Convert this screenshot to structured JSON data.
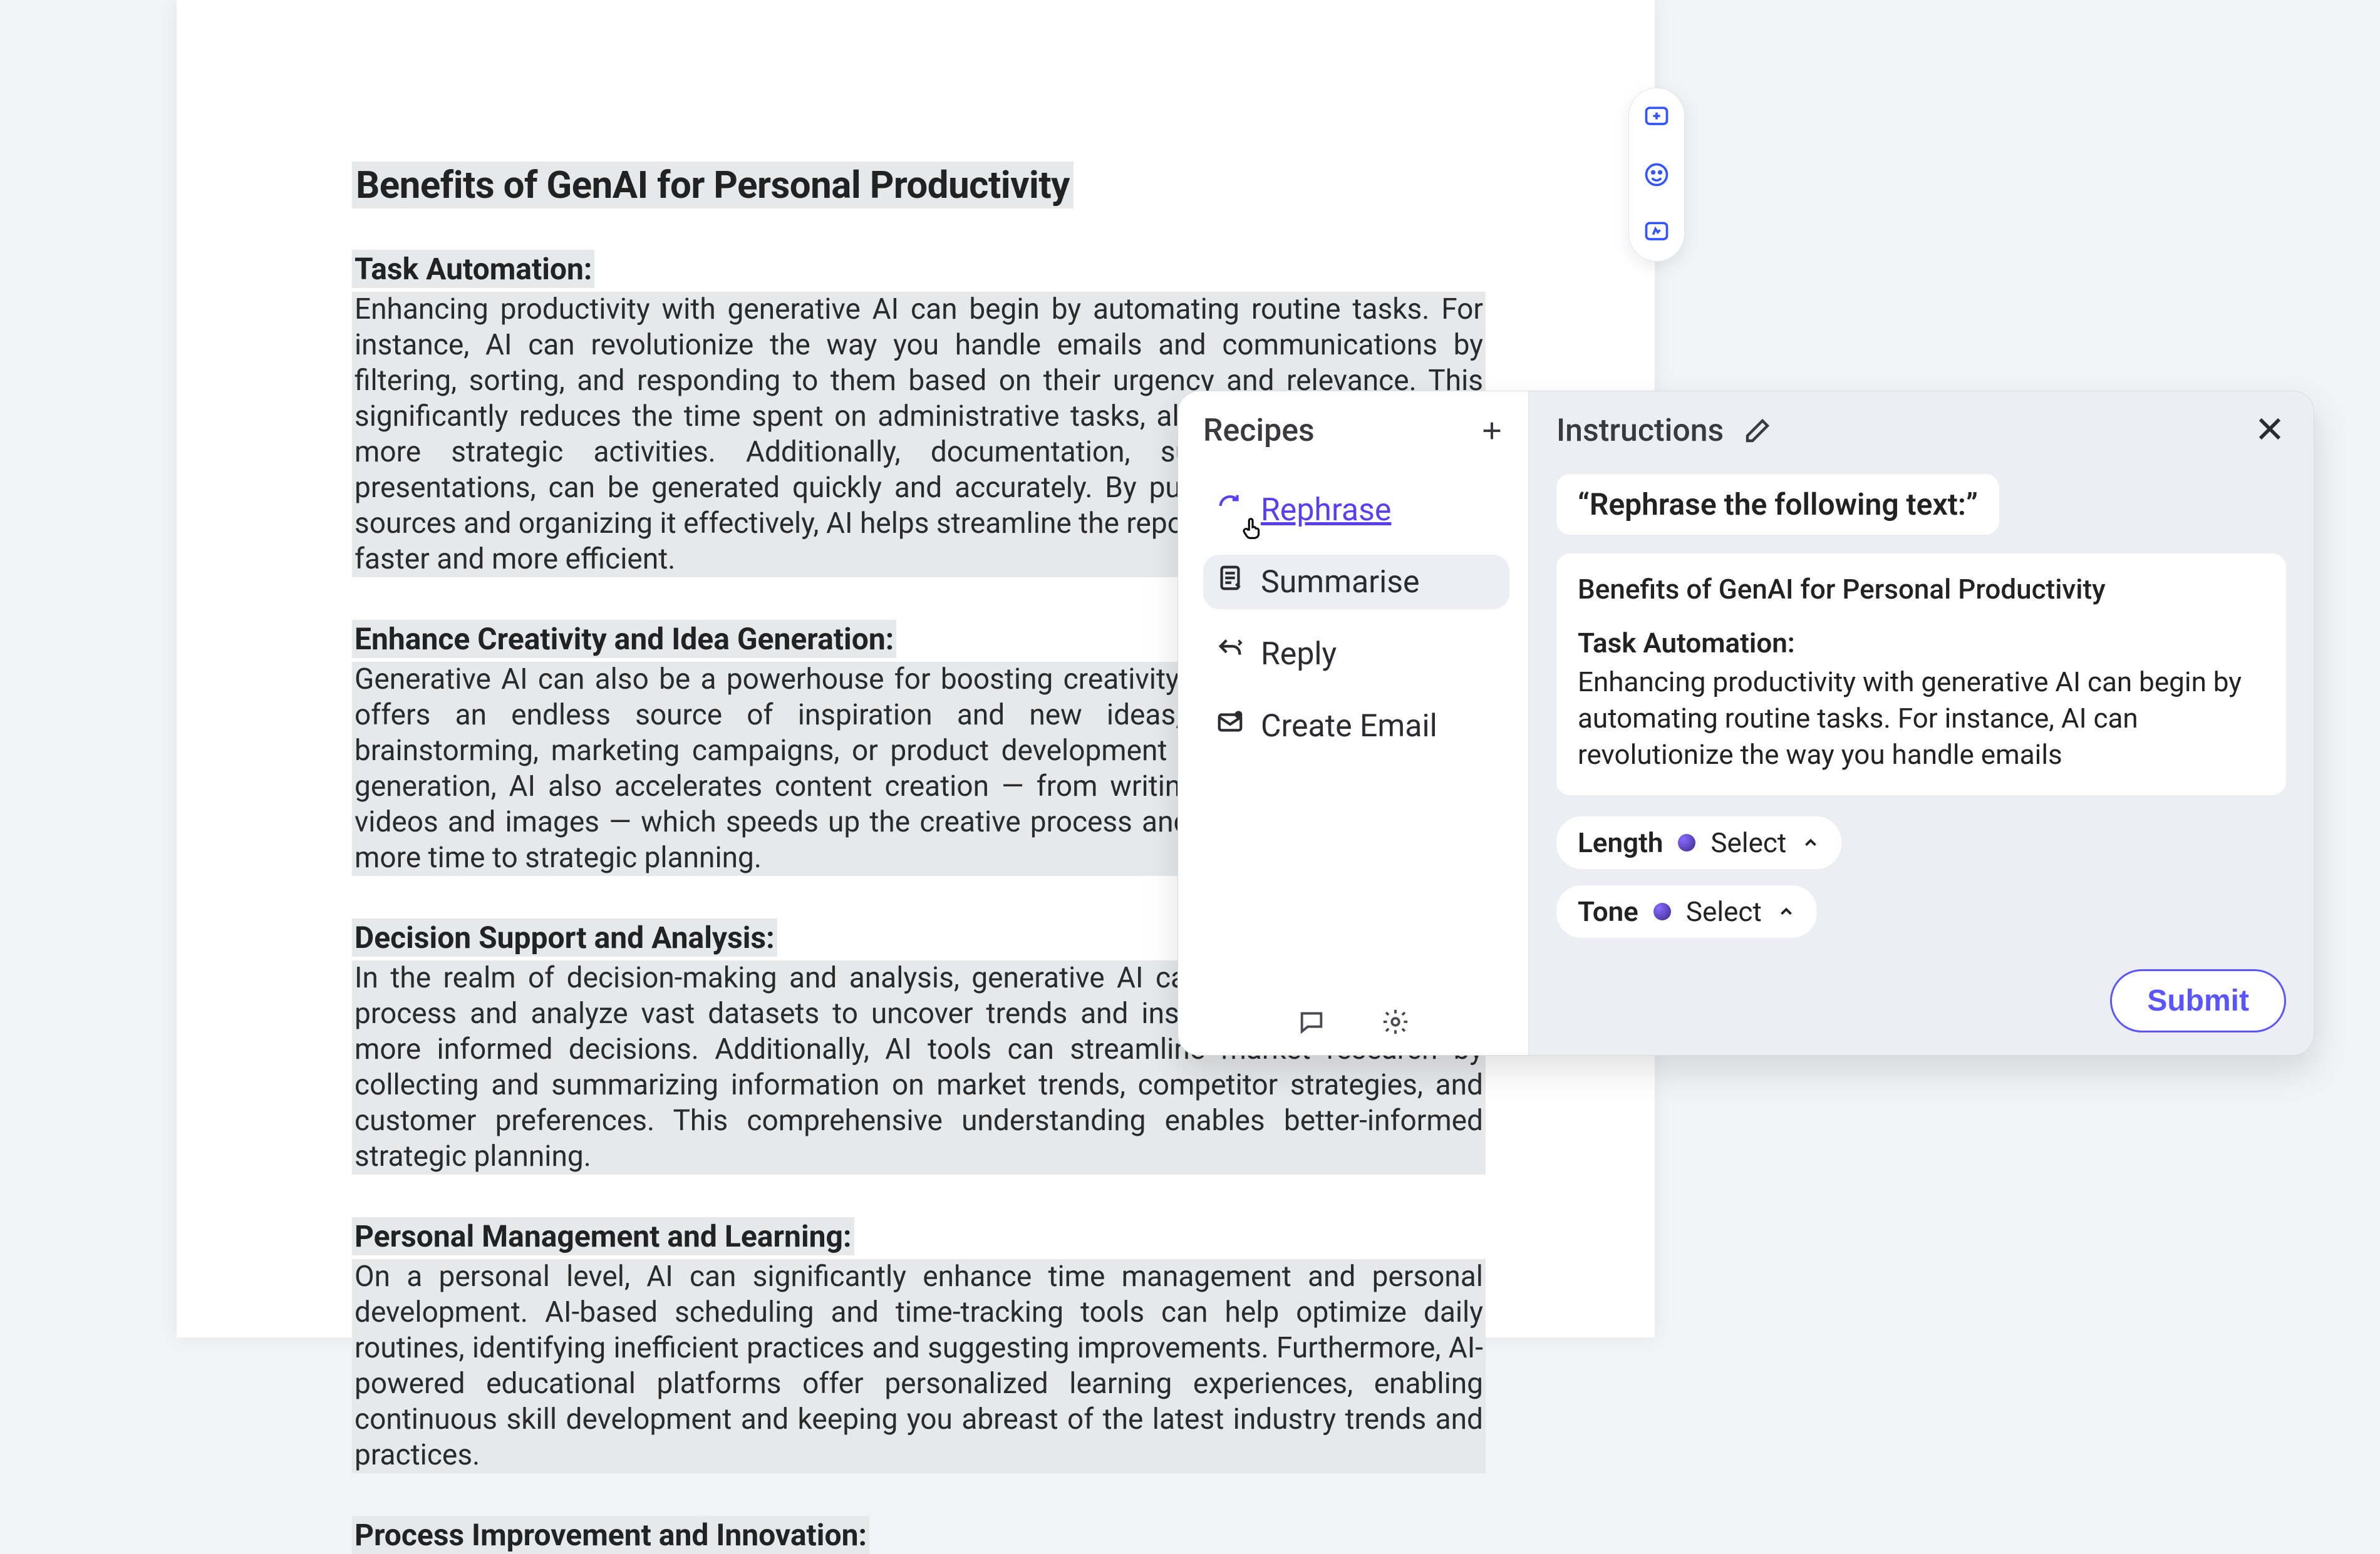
{
  "document": {
    "title": "Benefits of GenAI for Personal Productivity",
    "sections": [
      {
        "heading": "Task Automation:",
        "body": "Enhancing productivity with generative AI can begin by automating routine tasks. For instance, AI can revolutionize the way you handle emails and communications by filtering, sorting, and responding to them based on their urgency and relevance. This significantly reduces the time spent on administrative tasks, allowing you to focus on more strategic activities. Additionally, documentation, such as reports and presentations, can be generated quickly and accurately. By pulling data from various sources and organizing it effectively, AI helps streamline the reporting process, making it faster and more efficient."
      },
      {
        "heading": "Enhance Creativity and Idea Generation:",
        "body": "Generative AI can also be a powerhouse for boosting creativity and idea generation. It offers an endless source of inspiration and new ideas, whether for project brainstorming, marketing campaigns, or product development initiatives. Beyond idea generation, AI also accelerates content creation — from writing articles to producing videos and images — which speeds up the creative process and allows you to allocate more time to strategic planning."
      },
      {
        "heading": "Decision Support and Analysis:",
        "body": "In the realm of decision-making and analysis, generative AI can be invaluable. It can process and analyze vast datasets to uncover trends and insights, aiding in making more informed decisions. Additionally, AI tools can streamline market research by collecting and summarizing information on market trends, competitor strategies, and customer preferences. This comprehensive understanding enables better-informed strategic planning."
      },
      {
        "heading": "Personal Management and Learning:",
        "body": "On a personal level, AI can significantly enhance time management and personal development. AI-based scheduling and time-tracking tools can help optimize daily routines, identifying inefficient practices and suggesting improvements. Furthermore, AI-powered educational platforms offer personalized learning experiences, enabling continuous skill development and keeping you abreast of the latest industry trends and practices."
      },
      {
        "heading": "Process Improvement and Innovation:",
        "body": ""
      }
    ]
  },
  "toolbar": {
    "add_comment": "add-comment",
    "emoji": "emoji",
    "suggest": "suggest-edit"
  },
  "popup": {
    "recipes_title": "Recipes",
    "instructions_title": "Instructions",
    "items": [
      {
        "label": "Rephrase",
        "icon": "rephrase-icon",
        "active": true
      },
      {
        "label": "Summarise",
        "icon": "summarise-icon",
        "hovered": true
      },
      {
        "label": "Reply",
        "icon": "reply-icon"
      },
      {
        "label": "Create Email",
        "icon": "email-icon"
      }
    ],
    "prompt": "“Rephrase the following text:”",
    "preview": {
      "title": "Benefits of GenAI for Personal Productivity",
      "subheading": "Task Automation:",
      "body": "Enhancing productivity with generative AI can begin by automating routine tasks. For instance, AI can revolutionize the way you handle emails"
    },
    "params": {
      "length_label": "Length",
      "length_value": "Select",
      "tone_label": "Tone",
      "tone_value": "Select"
    },
    "submit_label": "Submit"
  }
}
